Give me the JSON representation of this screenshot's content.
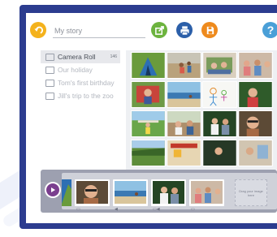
{
  "toolbar": {
    "title_placeholder": "My story",
    "help_glyph": "?",
    "icons": [
      "back-icon",
      "share-icon",
      "print-icon",
      "save-icon",
      "help-icon"
    ]
  },
  "sidebar": {
    "items": [
      {
        "label": "Camera Roll",
        "count": "146",
        "selected": true
      },
      {
        "label": "Our holiday",
        "selected": false
      },
      {
        "label": "Tom's first birthday",
        "selected": false
      },
      {
        "label": "Jill's trip to the zoo",
        "selected": false
      }
    ]
  },
  "timeline": {
    "drop_text": "Drag your image here",
    "clips": [
      {
        "icon": "text-note-icon"
      },
      {
        "icon": "audio-icon"
      },
      {
        "icon": "text-audio-icon"
      },
      {
        "icon": "text-note-icon"
      }
    ]
  },
  "colors": {
    "frame": "#2c3c8f",
    "accent_purple": "#7a3e8e",
    "back": "#f4b21c",
    "share": "#6cb33e",
    "print": "#2b5fa9",
    "save": "#ee8a1d",
    "help": "#4a9fd7"
  }
}
